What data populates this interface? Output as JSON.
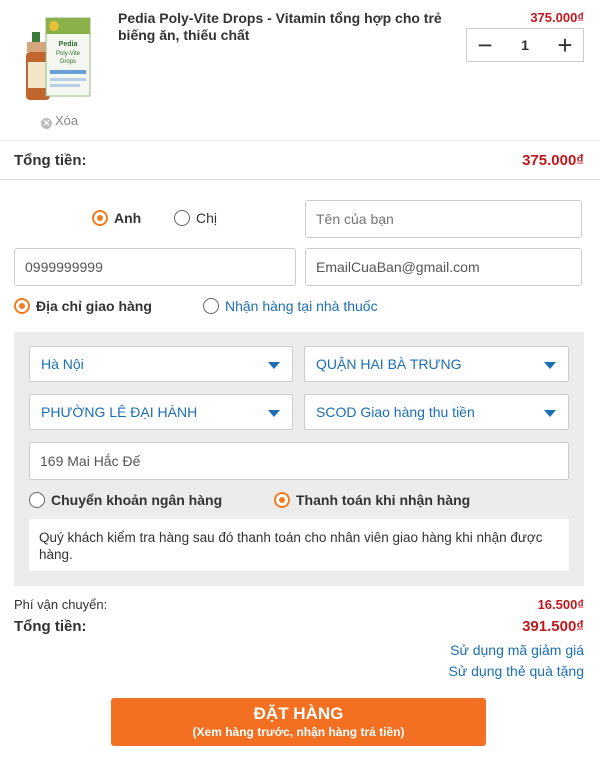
{
  "cart": {
    "product_name": "Pedia Poly-Vite Drops - Vitamin tổng hợp cho trẻ biếng ăn, thiếu chất",
    "price": "375.000₫",
    "quantity": "1",
    "remove_label": "Xóa",
    "minus_icon": "minus-icon",
    "plus_icon": "plus-icon",
    "image_text": {
      "brand": "Pedia",
      "line1": "Poly-Vite",
      "line2": "Drops"
    }
  },
  "subtotal": {
    "label": "Tổng tiền:",
    "value": "375.000₫"
  },
  "form": {
    "gender_options": [
      {
        "label": "Anh",
        "selected": true
      },
      {
        "label": "Chị",
        "selected": false
      }
    ],
    "name_placeholder": "Tên của bạn",
    "phone_value": "0999999999",
    "email_value": "EmailCuaBan@gmail.com",
    "delivery_options": [
      {
        "label": "Địa chỉ giao hàng",
        "selected": true
      },
      {
        "label": "Nhận hàng tại nhà thuốc",
        "selected": false
      }
    ],
    "city": "Hà Nội",
    "district": "QUẬN HAI BÀ TRƯNG",
    "ward": "PHƯỜNG LÊ ĐẠI HÀNH",
    "shipping_method": "SCOD Giao hàng thu tiền",
    "address_value": "169 Mai Hắc Đế",
    "payment_options": [
      {
        "label": "Chuyển khoản ngân hàng",
        "selected": false
      },
      {
        "label": "Thanh toán khi nhận hàng",
        "selected": true
      }
    ],
    "payment_note": "Quý khách kiểm tra hàng sau đó thanh toán cho nhân viên giao hàng khi nhận được hàng."
  },
  "summary": {
    "shipping_label": "Phí vận chuyển:",
    "shipping_value": "16.500₫",
    "total_label": "Tổng tiền:",
    "total_value": "391.500₫",
    "coupon_link": "Sử dụng mã giảm giá",
    "gift_card_link": "Sử dụng thẻ quà tặng"
  },
  "order_button": {
    "label": "ĐẶT HÀNG",
    "sublabel": "(Xem hàng trước, nhận hàng trả tiền)"
  },
  "colors": {
    "accent": "#f47c20",
    "price_red": "#c0171c",
    "link_blue": "#1b6fb5",
    "button_orange": "#f36f21"
  }
}
